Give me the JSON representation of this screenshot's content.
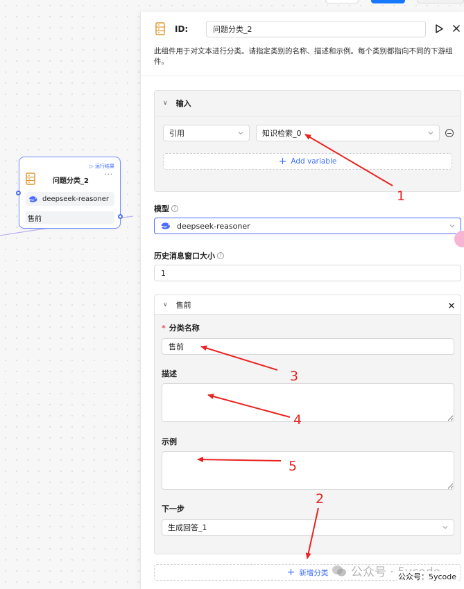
{
  "node": {
    "run_label": "运行结果",
    "title": "问题分类_2",
    "more": "···",
    "model": "deepseek-reasoner",
    "branch": "售前"
  },
  "panel": {
    "id_label": "ID:",
    "id_value": "问题分类_2",
    "description": "此组件用于对文本进行分类。请指定类别的名称、描述和示例。每个类别都指向不同的下游组件。",
    "input_section": {
      "title": "输入",
      "ref_type": "引用",
      "ref_value": "知识检索_0",
      "add_variable": "Add variable"
    },
    "model_label": "模型",
    "model_value": "deepseek-reasoner",
    "history_label": "历史消息窗口大小",
    "history_value": "1",
    "category": {
      "title": "售前",
      "name_label": "分类名称",
      "name_value": "售前",
      "desc_label": "描述",
      "desc_value": "",
      "example_label": "示例",
      "example_value": "",
      "next_label": "下一步",
      "next_value": "生成回答_1"
    },
    "add_category": "新增分类"
  },
  "annotations": [
    "1",
    "2",
    "3",
    "4",
    "5"
  ],
  "watermark": {
    "main": "公众号 · 5ycode",
    "small": "公众号：5ycode"
  },
  "colors": {
    "accent": "#3b6cff",
    "node_border": "#6e8cff",
    "arrow": "#e8231f",
    "required": "#e34d59"
  }
}
